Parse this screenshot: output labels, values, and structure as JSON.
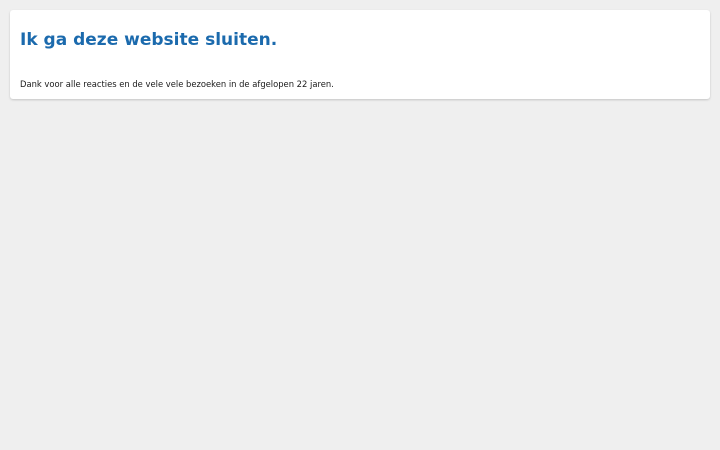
{
  "page": {
    "background_color": "#efefef",
    "card_color": "#ffffff",
    "title_color": "#1b6aad"
  },
  "notice": {
    "title": "Ik ga deze website sluiten.",
    "message": "Dank voor alle reacties en de vele vele bezoeken in de afgelopen 22 jaren."
  }
}
